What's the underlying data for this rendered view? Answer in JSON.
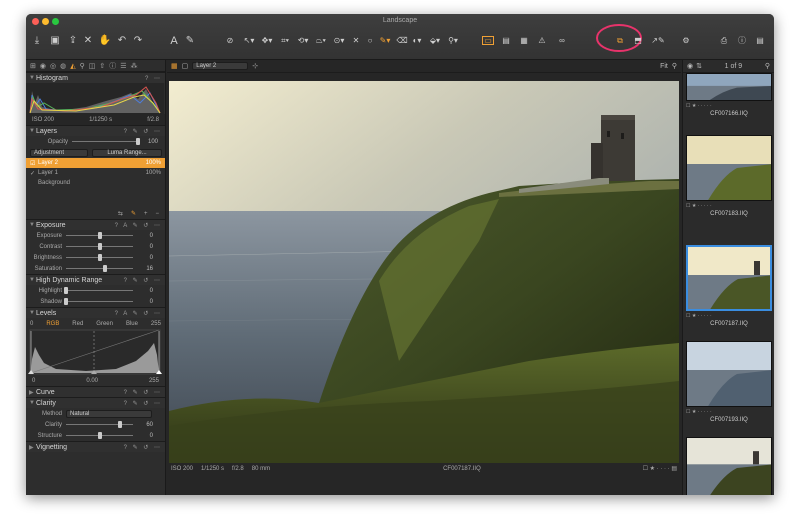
{
  "window": {
    "title": "Landscape"
  },
  "colors": {
    "accent": "#f0a034",
    "highlight_circle": "#e8336b",
    "selection": "#3a8de0"
  },
  "toolbar": {
    "left_icons": [
      "import-icon",
      "camera-icon",
      "export-icon",
      "close-x-icon",
      "hand-icon",
      "undo-icon",
      "redo-icon"
    ],
    "cursor_icons": [
      "text-icon",
      "brush-icon",
      "pan-icon",
      "select-icon",
      "crop-icon",
      "rotate-icon",
      "keystone-icon",
      "spot-icon",
      "circle-icon",
      "draw-mask-icon",
      "erase-mask-icon",
      "gradient-icon",
      "picker-icon"
    ],
    "view_icons": [
      "overlay-icon",
      "filmstrip-icon",
      "grid-icon",
      "warning-icon",
      "glasses-icon"
    ],
    "right_icons": [
      "layers-copy-icon",
      "stack-icon",
      "apply-icon",
      "settings-icon",
      "print-icon",
      "info-icon",
      "panel-icon"
    ]
  },
  "left": {
    "histogram": {
      "title": "Histogram",
      "iso": "ISO 200",
      "shutter": "1/1250 s",
      "aperture": "f/2.8"
    },
    "layers": {
      "title": "Layers",
      "opacity_label": "Opacity",
      "opacity_value": "100",
      "adjustment_label": "Adjustment",
      "luma_label": "Luma Range...",
      "items": [
        {
          "name": "Layer 2",
          "value": "100%"
        },
        {
          "name": "Layer 1",
          "value": "100%"
        },
        {
          "name": "Background",
          "value": ""
        }
      ]
    },
    "exposure": {
      "title": "Exposure",
      "rows": [
        {
          "label": "Exposure",
          "value": "0",
          "pct": 50
        },
        {
          "label": "Contrast",
          "value": "0",
          "pct": 50
        },
        {
          "label": "Brightness",
          "value": "0",
          "pct": 50
        },
        {
          "label": "Saturation",
          "value": "16",
          "pct": 58
        }
      ]
    },
    "hdr": {
      "title": "High Dynamic Range",
      "rows": [
        {
          "label": "Highlight",
          "value": "0",
          "pct": 0
        },
        {
          "label": "Shadow",
          "value": "0",
          "pct": 0
        }
      ]
    },
    "levels": {
      "title": "Levels",
      "low_out": "0",
      "high_out": "255",
      "tabs": [
        "RGB",
        "Red",
        "Green",
        "Blue"
      ],
      "low": "0",
      "mid": "0.00",
      "high": "255"
    },
    "curve": {
      "title": "Curve"
    },
    "clarity": {
      "title": "Clarity",
      "method_label": "Method",
      "method_value": "Natural",
      "rows": [
        {
          "label": "Clarity",
          "value": "60",
          "pct": 80
        },
        {
          "label": "Structure",
          "value": "0",
          "pct": 50
        }
      ]
    },
    "vignetting": {
      "title": "Vignetting"
    }
  },
  "viewer": {
    "layer_select": "Layer 2",
    "zoom": "Fit",
    "footer": {
      "iso": "ISO 200",
      "shutter": "1/1250 s",
      "aperture": "f/2.8",
      "focal": "80 mm",
      "filename": "CF007187.IIQ"
    }
  },
  "browser": {
    "count": "1 of 9",
    "thumbs": [
      {
        "name": "CF007166.IIQ",
        "selected": false
      },
      {
        "name": "CF007183.IIQ",
        "selected": false
      },
      {
        "name": "CF007187.IIQ",
        "selected": true
      },
      {
        "name": "CF007193.IIQ",
        "selected": false
      },
      {
        "name": "CF007200.IIQ",
        "selected": false
      }
    ]
  }
}
